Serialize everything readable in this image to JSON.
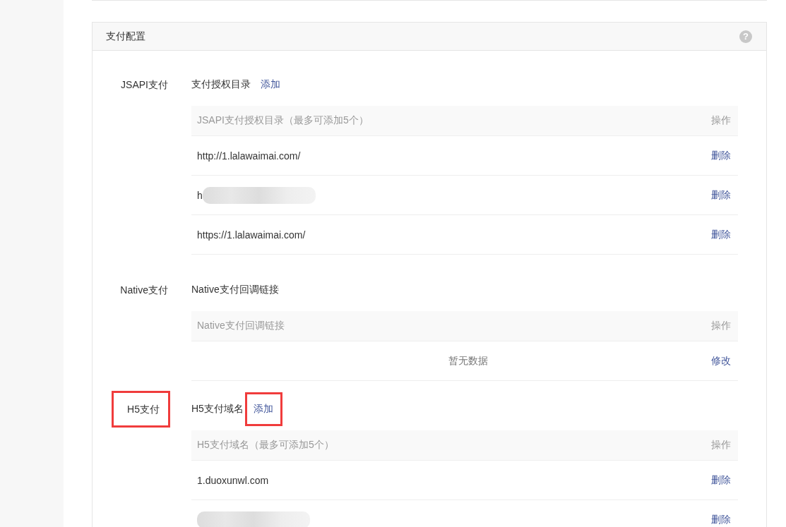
{
  "card": {
    "title": "支付配置",
    "help": "?"
  },
  "sections": [
    {
      "label": "JSAPI支付",
      "label_highlighted": false,
      "title": "支付授权目录",
      "add": {
        "text": "添加",
        "highlighted": false
      },
      "table": {
        "columns": [
          "JSAPI支付授权目录（最多可添加5个）",
          "操作"
        ],
        "rows": [
          {
            "url": "http://1.lalawaimai.com/",
            "redacted": false,
            "action": "删除"
          },
          {
            "url": "h",
            "redacted": true,
            "action": "删除"
          },
          {
            "url": "https://1.lalawaimai.com/",
            "redacted": false,
            "action": "删除"
          }
        ]
      }
    },
    {
      "label": "Native支付",
      "label_highlighted": false,
      "title": "Native支付回调链接",
      "table": {
        "columns": [
          "Native支付回调链接",
          "操作"
        ],
        "empty_text": "暂无数据",
        "empty_action": "修改"
      }
    },
    {
      "label": "H5支付",
      "label_highlighted": true,
      "title": "H5支付域名",
      "add": {
        "text": "添加",
        "highlighted": true
      },
      "table": {
        "columns": [
          "H5支付域名（最多可添加5个）",
          "操作"
        ],
        "rows": [
          {
            "url": "1.duoxunwl.com",
            "redacted": false,
            "action": "删除"
          },
          {
            "redacted": true,
            "action": "删除"
          }
        ]
      }
    }
  ]
}
